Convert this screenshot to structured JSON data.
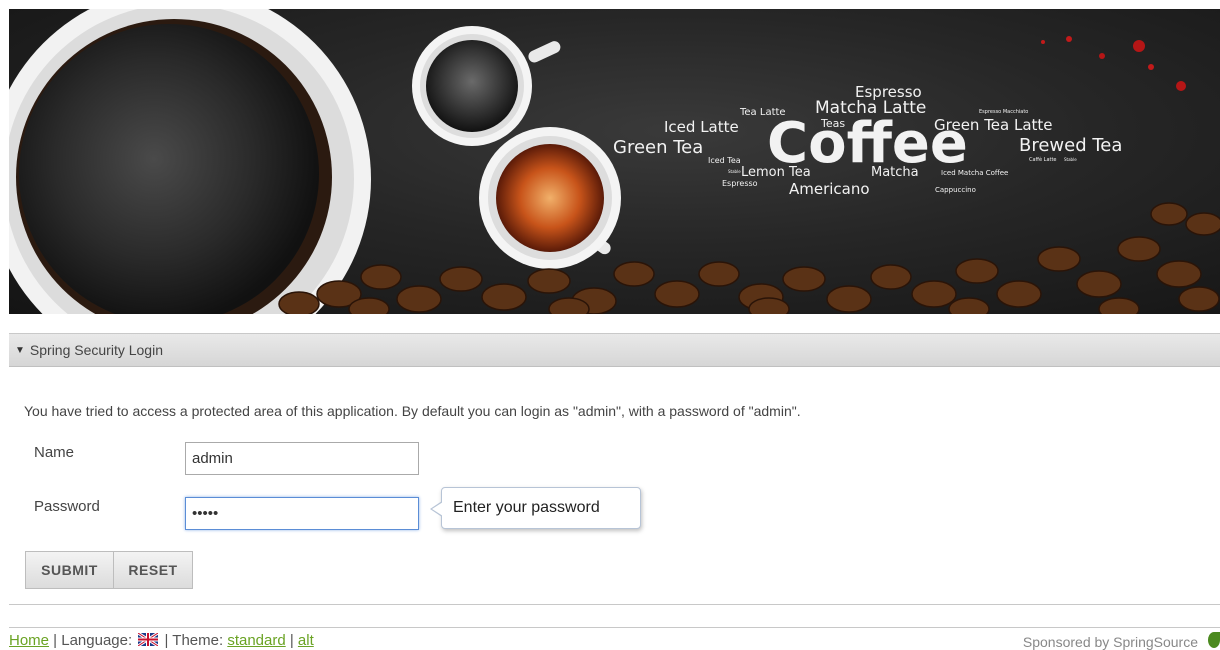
{
  "banner": {
    "words": {
      "espresso_top": "Espresso",
      "tea_latte": "Tea Latte",
      "matcha_latte": "Matcha Latte",
      "espresso_macchiato": "Espresso Macchiato",
      "iced_latte": "Iced Latte",
      "teas": "Teas",
      "green_tea_latte": "Green Tea Latte",
      "green_tea": "Green Tea",
      "coffee": "Coffee",
      "brewed_tea": "Brewed Tea",
      "iced_tea": "Iced Tea",
      "caffe_latte": "Caffè Latte",
      "stable_1": "Stable",
      "stable_2": "Stable",
      "lemon_tea": "Lemon Tea",
      "matcha": "Matcha",
      "iced_matcha_coffee": "Iced Matcha Coffee",
      "espresso_small": "Espresso",
      "americano": "Americano",
      "cappuccino": "Cappuccino"
    }
  },
  "panel": {
    "title": "Spring Security Login",
    "toggle_icon": "▼"
  },
  "intro_text": "You have tried to access a protected area of this application. By default you can login as \"admin\", with a password of \"admin\".",
  "form": {
    "name_label": "Name",
    "name_value": "admin",
    "password_label": "Password",
    "password_value": "admin",
    "tooltip": "Enter your password",
    "submit_label": "SUBMIT",
    "reset_label": "RESET"
  },
  "footer": {
    "home": "Home",
    "sep1": " | Language: ",
    "sep2": " | Theme: ",
    "theme_standard": "standard",
    "sep3": " | ",
    "theme_alt": "alt",
    "sponsor": "Sponsored by SpringSource"
  },
  "colors": {
    "link": "#6aa324",
    "focus_border": "#5b8dd6"
  }
}
